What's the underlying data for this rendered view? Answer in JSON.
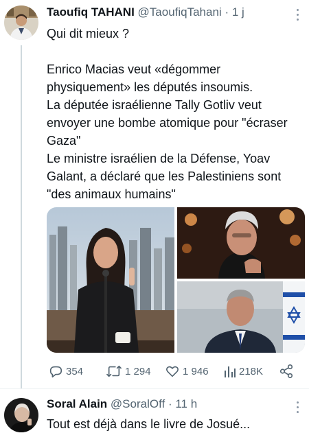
{
  "tweet": {
    "author_name": "Taoufiq TAHANI",
    "handle": "@TaoufiqTahani",
    "separator": "·",
    "time": "1 j",
    "text_lines": [
      "Qui dit mieux ?",
      "",
      "Enrico Macias veut «dégommer physiquement» les députés insoumis.",
      "La députée israélienne Tally Gotliv veut envoyer une bombe atomique pour \"écraser Gaza\"",
      "Le ministre israélien de la Défense, Yoav Galant, a déclaré que les Palestiniens sont \"des animaux humains\""
    ],
    "media": {
      "images": [
        {
          "name": "tv-studio-woman-photo"
        },
        {
          "name": "older-man-portrait-photo"
        },
        {
          "name": "minister-with-flag-photo"
        }
      ]
    },
    "stats": {
      "replies": "354",
      "retweets": "1 294",
      "likes": "1 946",
      "views": "218K"
    },
    "colors": {
      "text": "#0f1419",
      "secondary": "#536471",
      "thread_line": "#cfd9de"
    }
  },
  "reply": {
    "author_name": "Soral Alain",
    "handle": "@SoralOff",
    "separator": "·",
    "time": "11 h",
    "text": "Tout est déjà dans le livre de Josué..."
  }
}
